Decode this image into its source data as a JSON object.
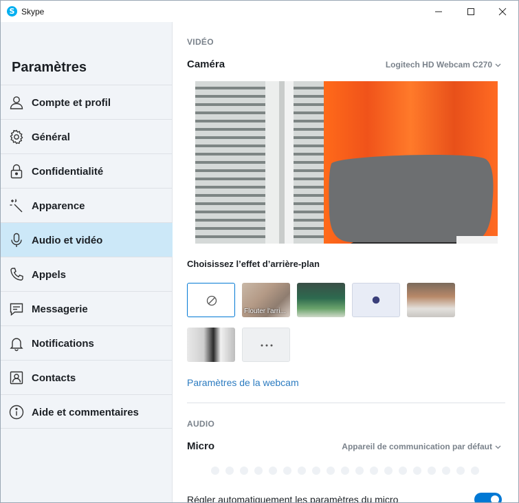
{
  "window": {
    "app_title": "Skype",
    "app_logo_letter": "S"
  },
  "sidebar": {
    "title": "Paramètres",
    "items": [
      {
        "label": "Compte et profil",
        "icon": "person-icon"
      },
      {
        "label": "Général",
        "icon": "gear-icon"
      },
      {
        "label": "Confidentialité",
        "icon": "lock-icon"
      },
      {
        "label": "Apparence",
        "icon": "magic-wand-icon"
      },
      {
        "label": "Audio et vidéo",
        "icon": "microphone-icon",
        "active": true
      },
      {
        "label": "Appels",
        "icon": "phone-icon"
      },
      {
        "label": "Messagerie",
        "icon": "chat-icon"
      },
      {
        "label": "Notifications",
        "icon": "bell-icon"
      },
      {
        "label": "Contacts",
        "icon": "contact-card-icon"
      },
      {
        "label": "Aide et commentaires",
        "icon": "info-icon"
      }
    ]
  },
  "video": {
    "section_title": "VIDÉO",
    "camera_label": "Caméra",
    "camera_device": "Logitech HD Webcam C270",
    "background_title": "Choisissez l’effet d’arrière-plan",
    "blur_caption": "Flouter l'arri...",
    "webcam_settings_link": "Paramètres de la webcam"
  },
  "audio": {
    "section_title": "AUDIO",
    "micro_label": "Micro",
    "micro_device": "Appareil de communication par défaut",
    "auto_adjust_label": "Régler automatiquement les paramètres du micro",
    "auto_adjust_enabled": true
  },
  "colors": {
    "accent": "#0078d4",
    "active_item": "#cce8f8",
    "link": "#2b7bc0"
  }
}
